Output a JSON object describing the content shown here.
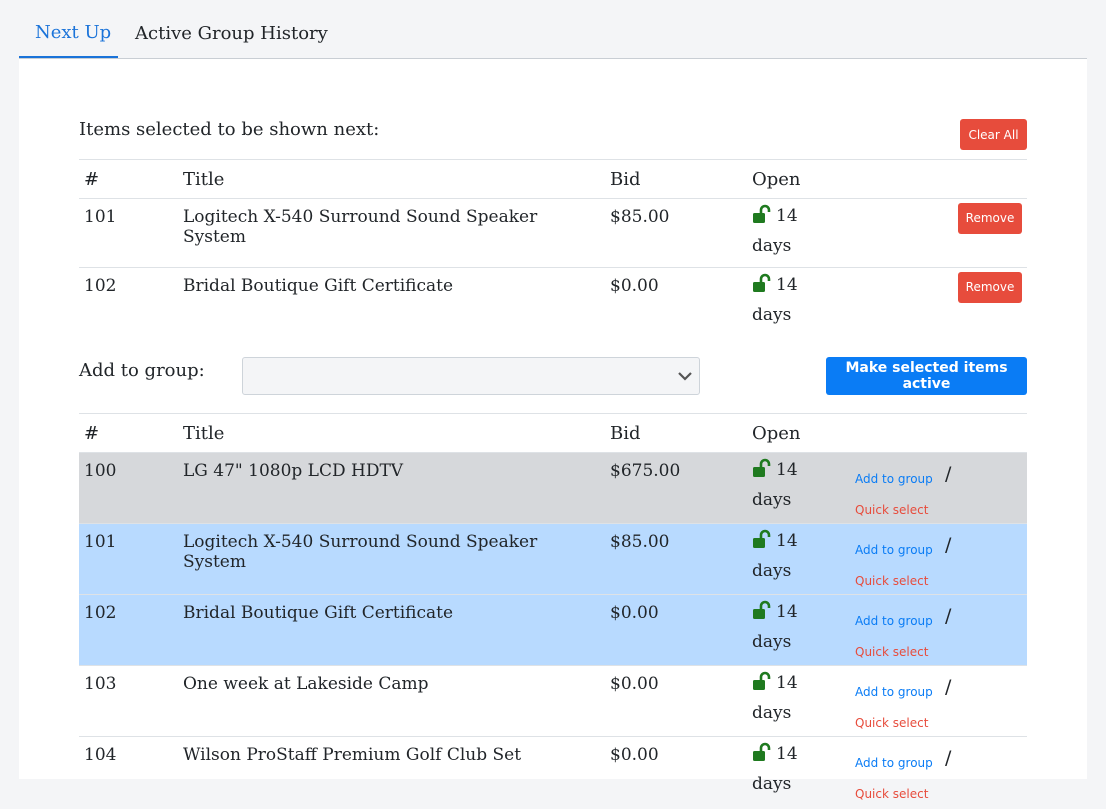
{
  "tabs": {
    "next_up": "Next Up",
    "history": "Active Group History"
  },
  "selected": {
    "heading": "Items selected to be shown next:",
    "clear_all": "Clear All",
    "columns": {
      "num": "#",
      "title": "Title",
      "bid": "Bid",
      "open": "Open"
    },
    "remove_label": "Remove",
    "rows": [
      {
        "num": "101",
        "title": "Logitech X-540 Surround Sound Speaker System",
        "bid": "$85.00",
        "open_num": "14",
        "open_unit": "days"
      },
      {
        "num": "102",
        "title": "Bridal Boutique Gift Certificate",
        "bid": "$0.00",
        "open_num": "14",
        "open_unit": "days"
      }
    ]
  },
  "group": {
    "label": "Add to group:",
    "select_value": "",
    "make_active": "Make selected items active"
  },
  "items": {
    "columns": {
      "num": "#",
      "title": "Title",
      "bid": "Bid",
      "open": "Open"
    },
    "add_label": "Add to group",
    "slash": "/",
    "quick_label": "Quick select",
    "rows": [
      {
        "num": "100",
        "title": "LG 47\" 1080p LCD HDTV",
        "bid": "$675.00",
        "open_num": "14",
        "open_unit": "days",
        "state": "gray"
      },
      {
        "num": "101",
        "title": "Logitech X-540 Surround Sound Speaker System",
        "bid": "$85.00",
        "open_num": "14",
        "open_unit": "days",
        "state": "blue"
      },
      {
        "num": "102",
        "title": "Bridal Boutique Gift Certificate",
        "bid": "$0.00",
        "open_num": "14",
        "open_unit": "days",
        "state": "blue"
      },
      {
        "num": "103",
        "title": "One week at Lakeside Camp",
        "bid": "$0.00",
        "open_num": "14",
        "open_unit": "days",
        "state": "none"
      },
      {
        "num": "104",
        "title": "Wilson ProStaff Premium Golf Club Set",
        "bid": "$0.00",
        "open_num": "14",
        "open_unit": "days",
        "state": "none"
      }
    ]
  },
  "colors": {
    "accent": "#0a7cf5",
    "danger": "#e74c3c",
    "lock": "#1f7a1f",
    "row_gray": "#d6d8db",
    "row_blue": "#b8daff"
  },
  "icons": {
    "open": "unlocked-padlock-icon",
    "select": "chevron-down-icon"
  }
}
